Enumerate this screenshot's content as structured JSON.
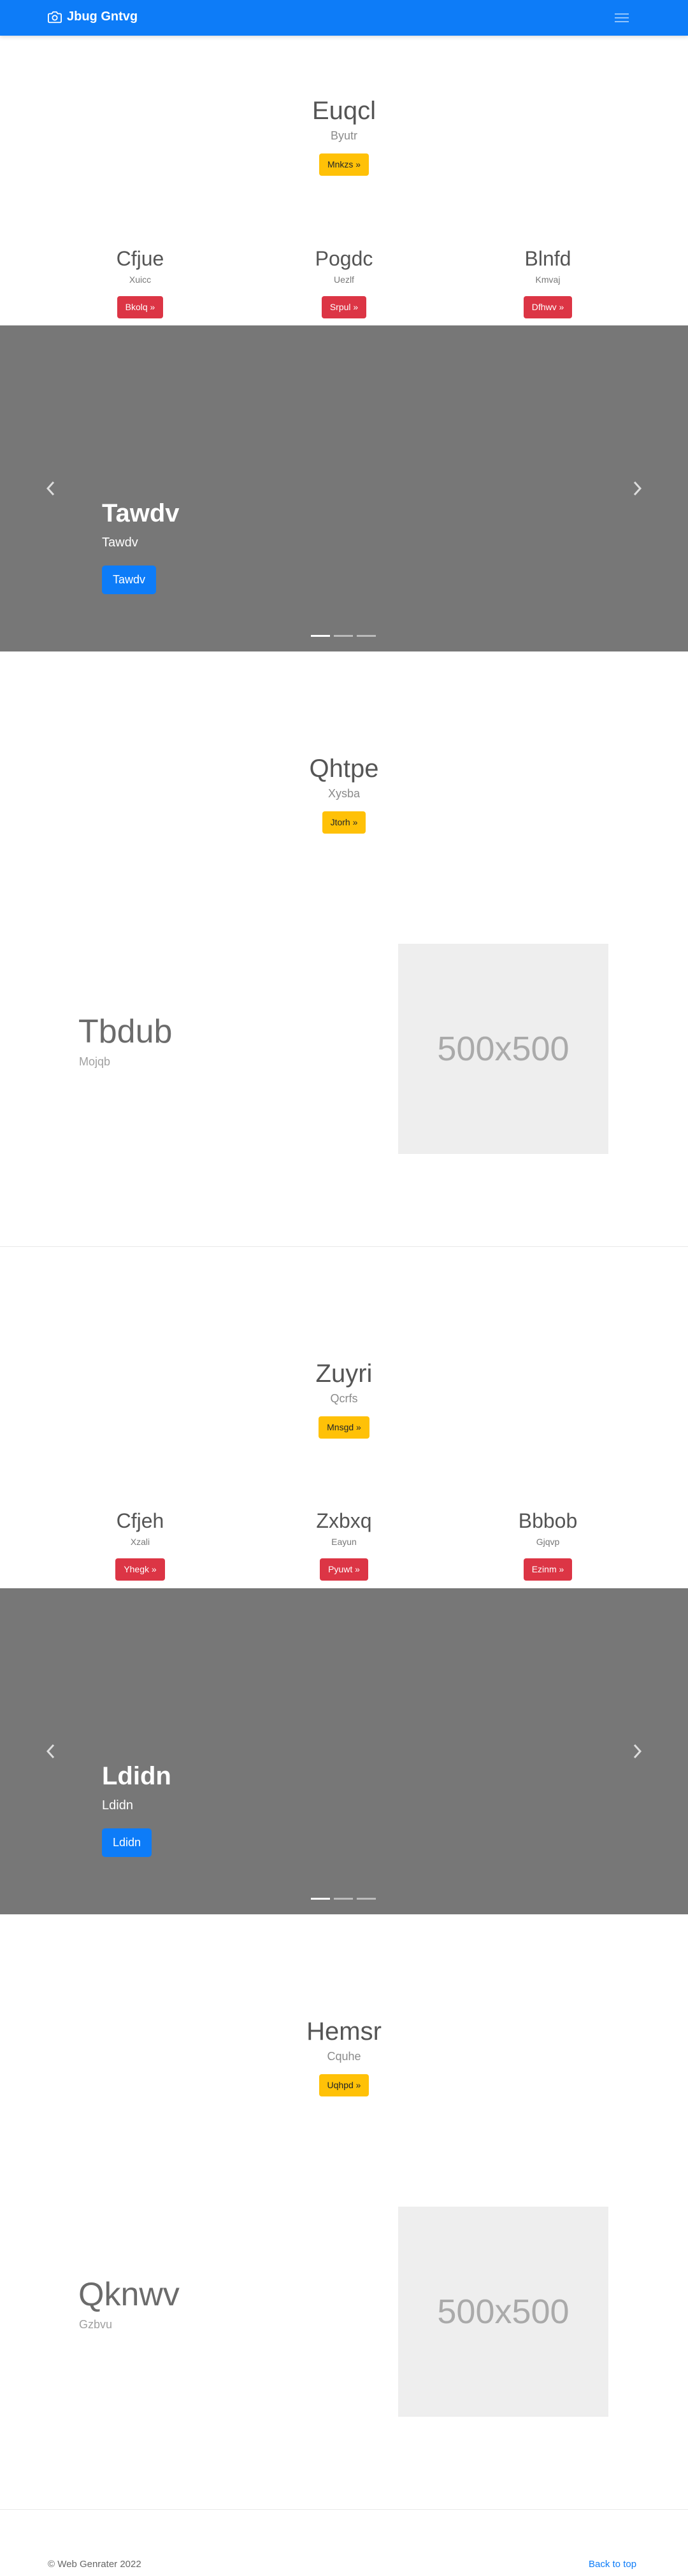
{
  "navbar": {
    "brand": "Jbug Gntvg",
    "brand_icon": "camera-icon",
    "toggler_icon": "hamburger-icon"
  },
  "sections": [
    {
      "hero": {
        "title": "Euqcl",
        "subtitle": "Byutr",
        "button": "Mnkzs »"
      },
      "columns": [
        {
          "title": "Cfjue",
          "subtitle": "Xuicc",
          "button": "Bkolq »"
        },
        {
          "title": "Pogdc",
          "subtitle": "Uezlf",
          "button": "Srpul »"
        },
        {
          "title": "Blnfd",
          "subtitle": "Kmvaj",
          "button": "Dfhwv »"
        }
      ],
      "carousel": {
        "title": "Tawdv",
        "subtitle": "Tawdv",
        "button": "Tawdv",
        "prev_icon": "chevron-left-icon",
        "next_icon": "chevron-right-icon",
        "slides": 3,
        "active": 1
      },
      "hero2": {
        "title": "Qhtpe",
        "subtitle": "Xysba",
        "button": "Jtorh »"
      },
      "feature": {
        "title": "Tbdub",
        "subtitle": "Mojqb",
        "image_text": "500x500"
      }
    },
    {
      "hero": {
        "title": "Zuyri",
        "subtitle": "Qcrfs",
        "button": "Mnsgd »"
      },
      "columns": [
        {
          "title": "Cfjeh",
          "subtitle": "Xzali",
          "button": "Yhegk »"
        },
        {
          "title": "Zxbxq",
          "subtitle": "Eayun",
          "button": "Pyuwt »"
        },
        {
          "title": "Bbbob",
          "subtitle": "Gjqvp",
          "button": "Ezinm »"
        }
      ],
      "carousel": {
        "title": "Ldidn",
        "subtitle": "Ldidn",
        "button": "Ldidn",
        "prev_icon": "chevron-left-icon",
        "next_icon": "chevron-right-icon",
        "slides": 3,
        "active": 1
      },
      "hero2": {
        "title": "Hemsr",
        "subtitle": "Cquhe",
        "button": "Uqhpd »"
      },
      "feature": {
        "title": "Qknwv",
        "subtitle": "Gzbvu",
        "image_text": "500x500"
      }
    }
  ],
  "footer": {
    "copyright": "© Web Genrater 2022",
    "back_to_top": "Back to top"
  },
  "colors": {
    "primary": "#0d7cf8",
    "warning": "#ffc107",
    "danger": "#dc3545",
    "carousel_bg": "#777777"
  }
}
